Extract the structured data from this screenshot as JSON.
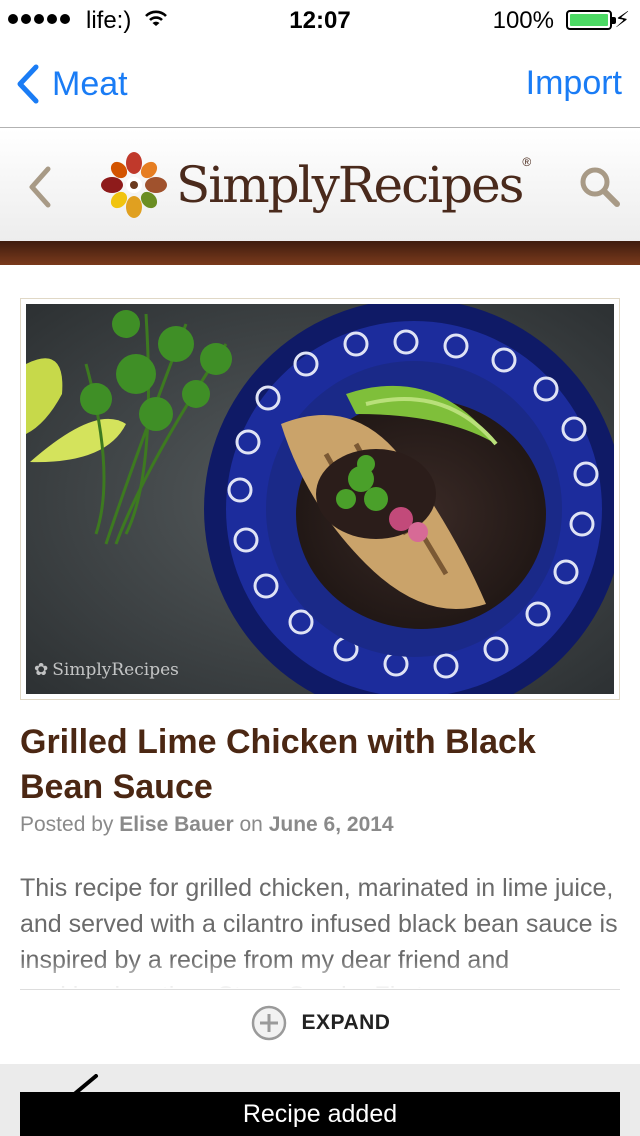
{
  "status_bar": {
    "carrier": "life:)",
    "time": "12:07",
    "battery": "100%"
  },
  "nav": {
    "back_label": "Meat",
    "import_label": "Import",
    "accent_color": "#1a7cf5"
  },
  "site": {
    "logo_text": "SimplyRecipes",
    "logo_mark": "®",
    "back_icon": "chevron-left-icon",
    "search_icon": "search-icon"
  },
  "article": {
    "photo_watermark": "SimplyRecipes",
    "title": "Grilled Lime Chicken with Black Bean Sauce",
    "byline_prefix": "Posted by",
    "author": "Elise Bauer",
    "byline_on": "on",
    "date": "June 6, 2014",
    "intro": "This recipe for grilled chicken, marinated in lime juice, and served with a cilantro infused black bean sauce is inspired by a recipe from my dear friend and cookbook author, Steve Sando. First"
  },
  "expand": {
    "label": "EXPAND",
    "icon": "plus-circle-icon"
  },
  "toast": {
    "message": "Recipe added"
  }
}
